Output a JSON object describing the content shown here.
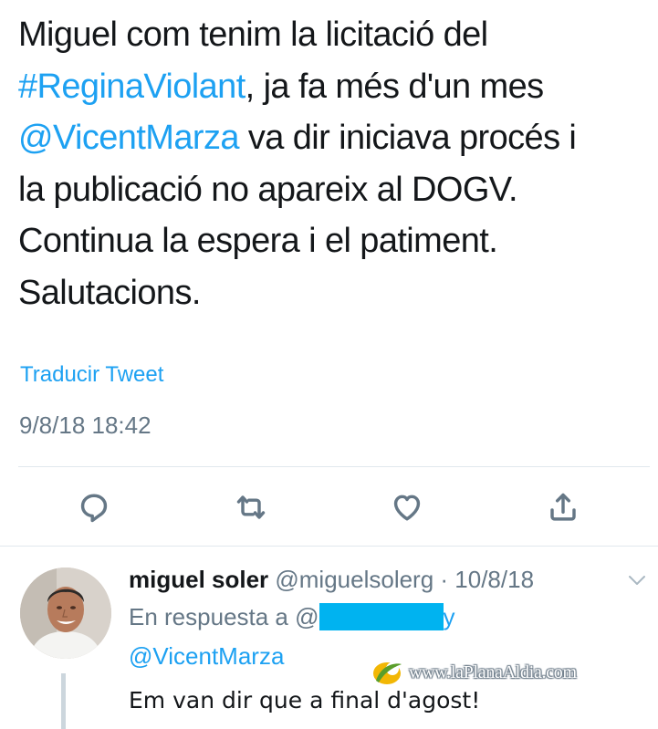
{
  "tweet": {
    "line1": "Miguel com tenim la licitació del",
    "hashtag": "#ReginaViolant",
    "line2_rest": ", ja fa més d'un mes",
    "mention": "@VicentMarza",
    "line3_rest": " va dir iniciava procés i",
    "line4": "la publicació no apareix al DOGV.",
    "line5": "Continua la espera i el patiment.",
    "line6": "Salutacions.",
    "translate_label": "Traducir Tweet",
    "timestamp": "9/8/18 18:42"
  },
  "actions": [
    "reply-icon",
    "retweet-icon",
    "like-icon",
    "share-icon"
  ],
  "reply": {
    "name": "miguel soler",
    "handle_date": " @miguelsolerg · 10/8/18",
    "in_reply_prefix": "En respuesta a @",
    "in_reply_suffix": "y",
    "mention": "@VicentMarza",
    "body": "Em van dir que a final d'agost!"
  },
  "watermark": {
    "text": "www.laPlanaAldia.com"
  },
  "colors": {
    "link": "#1da1f2",
    "secondary": "#657786",
    "redaction": "#00b3f0"
  }
}
